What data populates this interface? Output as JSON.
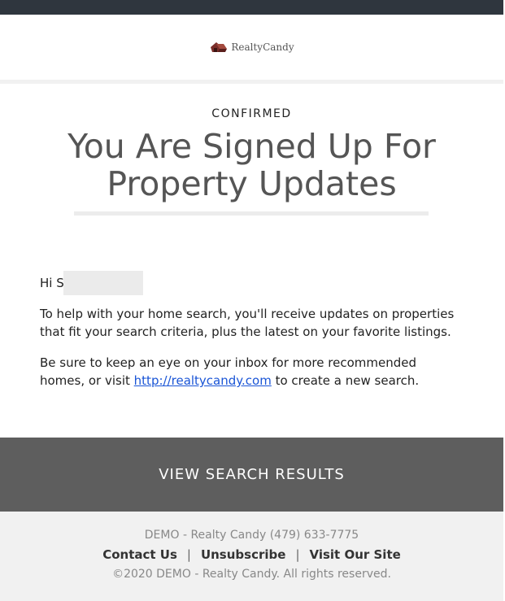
{
  "header": {
    "brand": "RealtyCandy",
    "logo_icon": "candy-house-icon"
  },
  "card": {
    "eyebrow": "CONFIRMED",
    "headline": "You Are Signed Up For Property Updates",
    "greeting": "Hi",
    "greeting_initial": "S",
    "paragraph1": "To help with your home search, you'll receive updates on properties that fit your search criteria, plus the latest on your favorite listings.",
    "paragraph2_before": "Be sure to keep an eye on your inbox for more recommended homes, or visit ",
    "paragraph2_link": "http://realtycandy.com",
    "paragraph2_after": " to create a new search."
  },
  "cta": {
    "label": "VIEW SEARCH RESULTS"
  },
  "footer": {
    "contact_line": "DEMO - Realty Candy (479) 633-7775",
    "links": [
      "Contact Us",
      "Unsubscribe",
      "Visit Our Site"
    ],
    "separator": "|",
    "copyright": "©2020 DEMO - Realty Candy. All rights reserved."
  },
  "colors": {
    "topbar": "#2f363e",
    "cta_background": "#5e5e5e",
    "link": "#1a55d6",
    "headline": "#555555"
  }
}
